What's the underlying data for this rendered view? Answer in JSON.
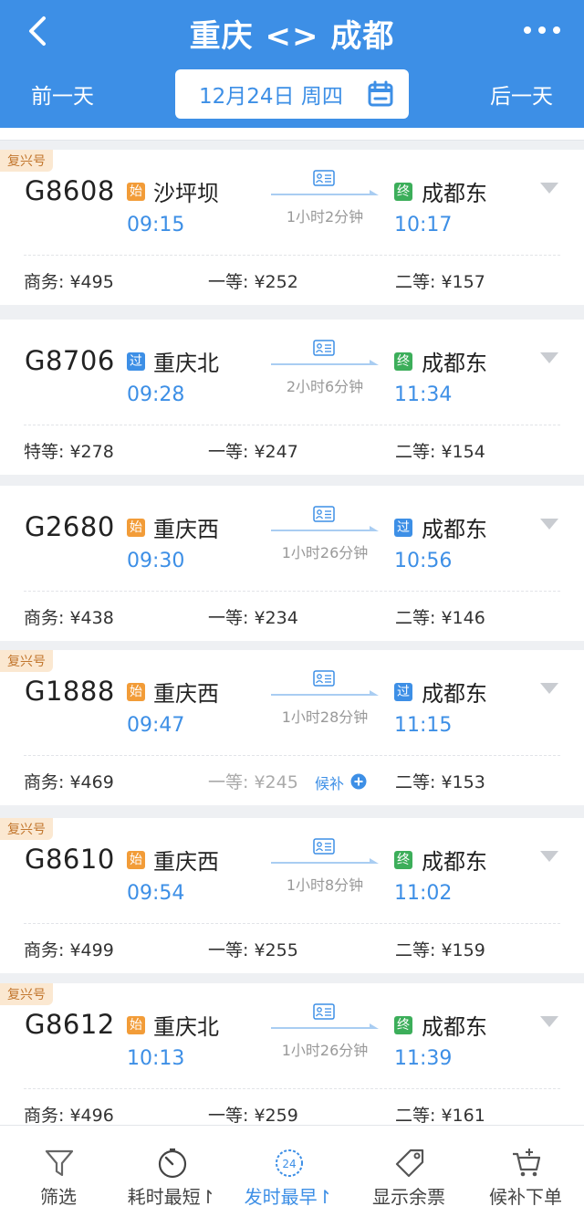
{
  "header": {
    "title": "重庆 <> 成都",
    "prev_day": "前一天",
    "next_day": "后一天",
    "date": "12月24日 周四",
    "accent_color": "#3d8fe6"
  },
  "trains": [
    {
      "badge": "复兴号",
      "no": "G8608",
      "dep_tag": "始",
      "dep_station": "沙坪坝",
      "dep_time": "09:15",
      "arr_tag": "终",
      "arr_station": "成都东",
      "arr_time": "10:17",
      "duration": "1小时2分钟",
      "seats": [
        {
          "label": "商务:",
          "price": "¥495"
        },
        {
          "label": "一等:",
          "price": "¥252"
        },
        {
          "label": "二等:",
          "price": "¥157"
        }
      ]
    },
    {
      "badge": "",
      "no": "G8706",
      "dep_tag": "过",
      "dep_station": "重庆北",
      "dep_time": "09:28",
      "arr_tag": "终",
      "arr_station": "成都东",
      "arr_time": "11:34",
      "duration": "2小时6分钟",
      "seats": [
        {
          "label": "特等:",
          "price": "¥278"
        },
        {
          "label": "一等:",
          "price": "¥247"
        },
        {
          "label": "二等:",
          "price": "¥154"
        }
      ]
    },
    {
      "badge": "",
      "no": "G2680",
      "dep_tag": "始",
      "dep_station": "重庆西",
      "dep_time": "09:30",
      "arr_tag": "过",
      "arr_station": "成都东",
      "arr_time": "10:56",
      "duration": "1小时26分钟",
      "seats": [
        {
          "label": "商务:",
          "price": "¥438"
        },
        {
          "label": "一等:",
          "price": "¥234"
        },
        {
          "label": "二等:",
          "price": "¥146"
        }
      ]
    },
    {
      "badge": "复兴号",
      "no": "G1888",
      "dep_tag": "始",
      "dep_station": "重庆西",
      "dep_time": "09:47",
      "arr_tag": "过",
      "arr_station": "成都东",
      "arr_time": "11:15",
      "duration": "1小时28分钟",
      "seats": [
        {
          "label": "商务:",
          "price": "¥469"
        },
        {
          "label": "一等:",
          "price": "¥245"
        },
        {
          "label": "二等:",
          "price": "¥153"
        }
      ],
      "waitlist": "候补"
    },
    {
      "badge": "复兴号",
      "no": "G8610",
      "dep_tag": "始",
      "dep_station": "重庆西",
      "dep_time": "09:54",
      "arr_tag": "终",
      "arr_station": "成都东",
      "arr_time": "11:02",
      "duration": "1小时8分钟",
      "seats": [
        {
          "label": "商务:",
          "price": "¥499"
        },
        {
          "label": "一等:",
          "price": "¥255"
        },
        {
          "label": "二等:",
          "price": "¥159"
        }
      ]
    },
    {
      "badge": "复兴号",
      "no": "G8612",
      "dep_tag": "始",
      "dep_station": "重庆北",
      "dep_time": "10:13",
      "arr_tag": "终",
      "arr_station": "成都东",
      "arr_time": "11:39",
      "duration": "1小时26分钟",
      "seats": [
        {
          "label": "商务:",
          "price": "¥496"
        },
        {
          "label": "一等:",
          "price": "¥259"
        },
        {
          "label": "二等:",
          "price": "¥161"
        }
      ]
    }
  ],
  "tabs": [
    {
      "label": "筛选",
      "icon": "filter-icon"
    },
    {
      "label": "耗时最短↾",
      "icon": "stopwatch-icon"
    },
    {
      "label": "发时最早↾",
      "icon": "clock-24-icon",
      "icon_text": "24"
    },
    {
      "label": "显示余票",
      "icon": "tag-icon"
    },
    {
      "label": "候补下单",
      "icon": "cart-plus-icon"
    }
  ]
}
